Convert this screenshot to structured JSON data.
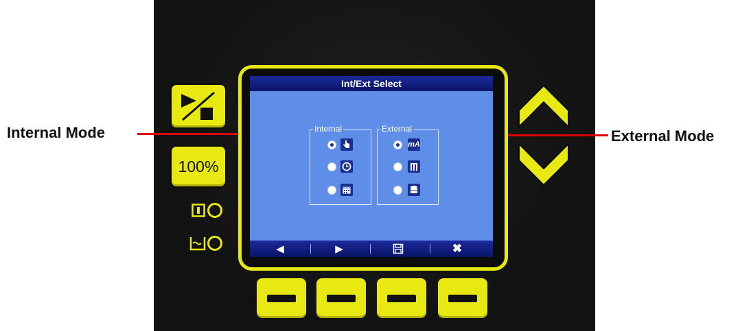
{
  "annotations": {
    "internal_mode": "Internal Mode",
    "external_mode": "External Mode"
  },
  "side_buttons": {
    "start_stop_icon": "play-stop-icon",
    "hundred_percent_label": "100%"
  },
  "screen": {
    "title": "Int/Ext Select",
    "internal_group": {
      "label": "Internal",
      "options": [
        {
          "icon": "hand-icon",
          "selected": true
        },
        {
          "icon": "clock-icon",
          "selected": false
        },
        {
          "icon": "calendar-icon",
          "selected": false
        }
      ]
    },
    "external_group": {
      "label": "External",
      "options": [
        {
          "icon": "ma-icon",
          "text": "mA",
          "selected": true
        },
        {
          "icon": "pulse-icon",
          "selected": false
        },
        {
          "icon": "database-icon",
          "selected": false
        }
      ]
    },
    "softkeys": [
      "left-arrow-icon",
      "right-arrow-icon",
      "save-icon",
      "close-icon"
    ]
  },
  "colors": {
    "panel_yellow": "#e8e812",
    "screen_blue": "#5f8ee8",
    "title_bar_navy": "#0a1468",
    "arrow_red": "#e00000"
  }
}
